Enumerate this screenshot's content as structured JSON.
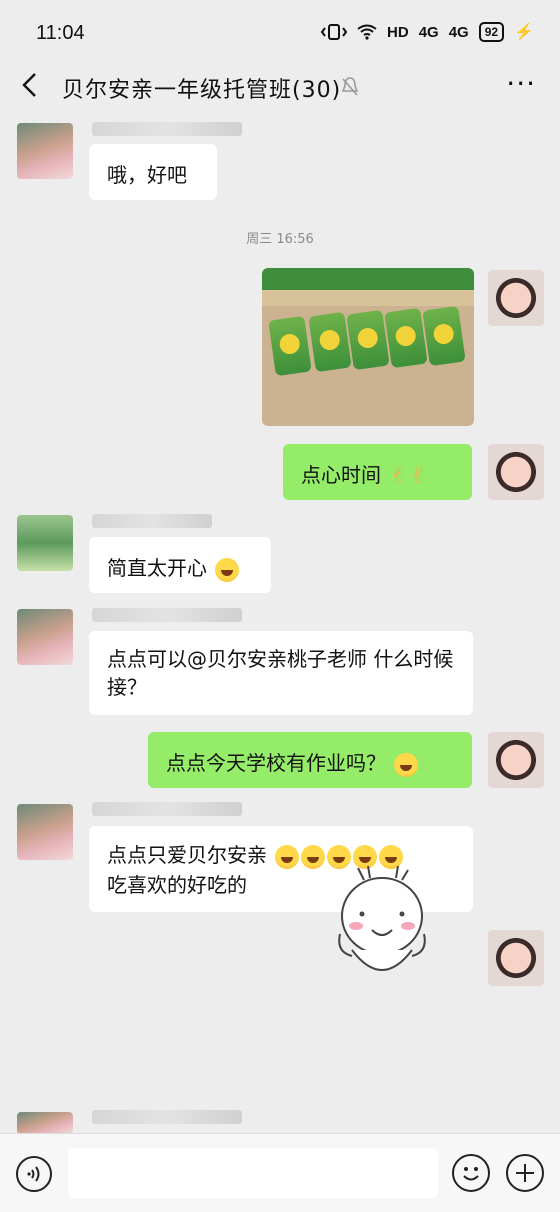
{
  "status_bar": {
    "time": "11:04",
    "network": "HD",
    "signal1": "4G",
    "signal2": "4G",
    "battery": "92"
  },
  "header": {
    "title": "贝尔安亲一年级托管班(30)"
  },
  "messages": [
    {
      "text": "哦，好吧"
    },
    {
      "timestamp": "周三 16:56"
    },
    {
      "text": "点心时间"
    },
    {
      "text": "简直太开心"
    },
    {
      "text": "点点可以@贝尔安亲桃子老师 什么时候接？"
    },
    {
      "text": "点点今天学校有作业吗？"
    },
    {
      "text_line1": "点点只爱贝尔安亲",
      "text_line2": "吃喜欢的好吃的"
    }
  ],
  "input": {
    "placeholder": ""
  },
  "colors": {
    "background": "#ededed",
    "self_bubble": "#95ec69",
    "other_bubble": "#ffffff"
  }
}
